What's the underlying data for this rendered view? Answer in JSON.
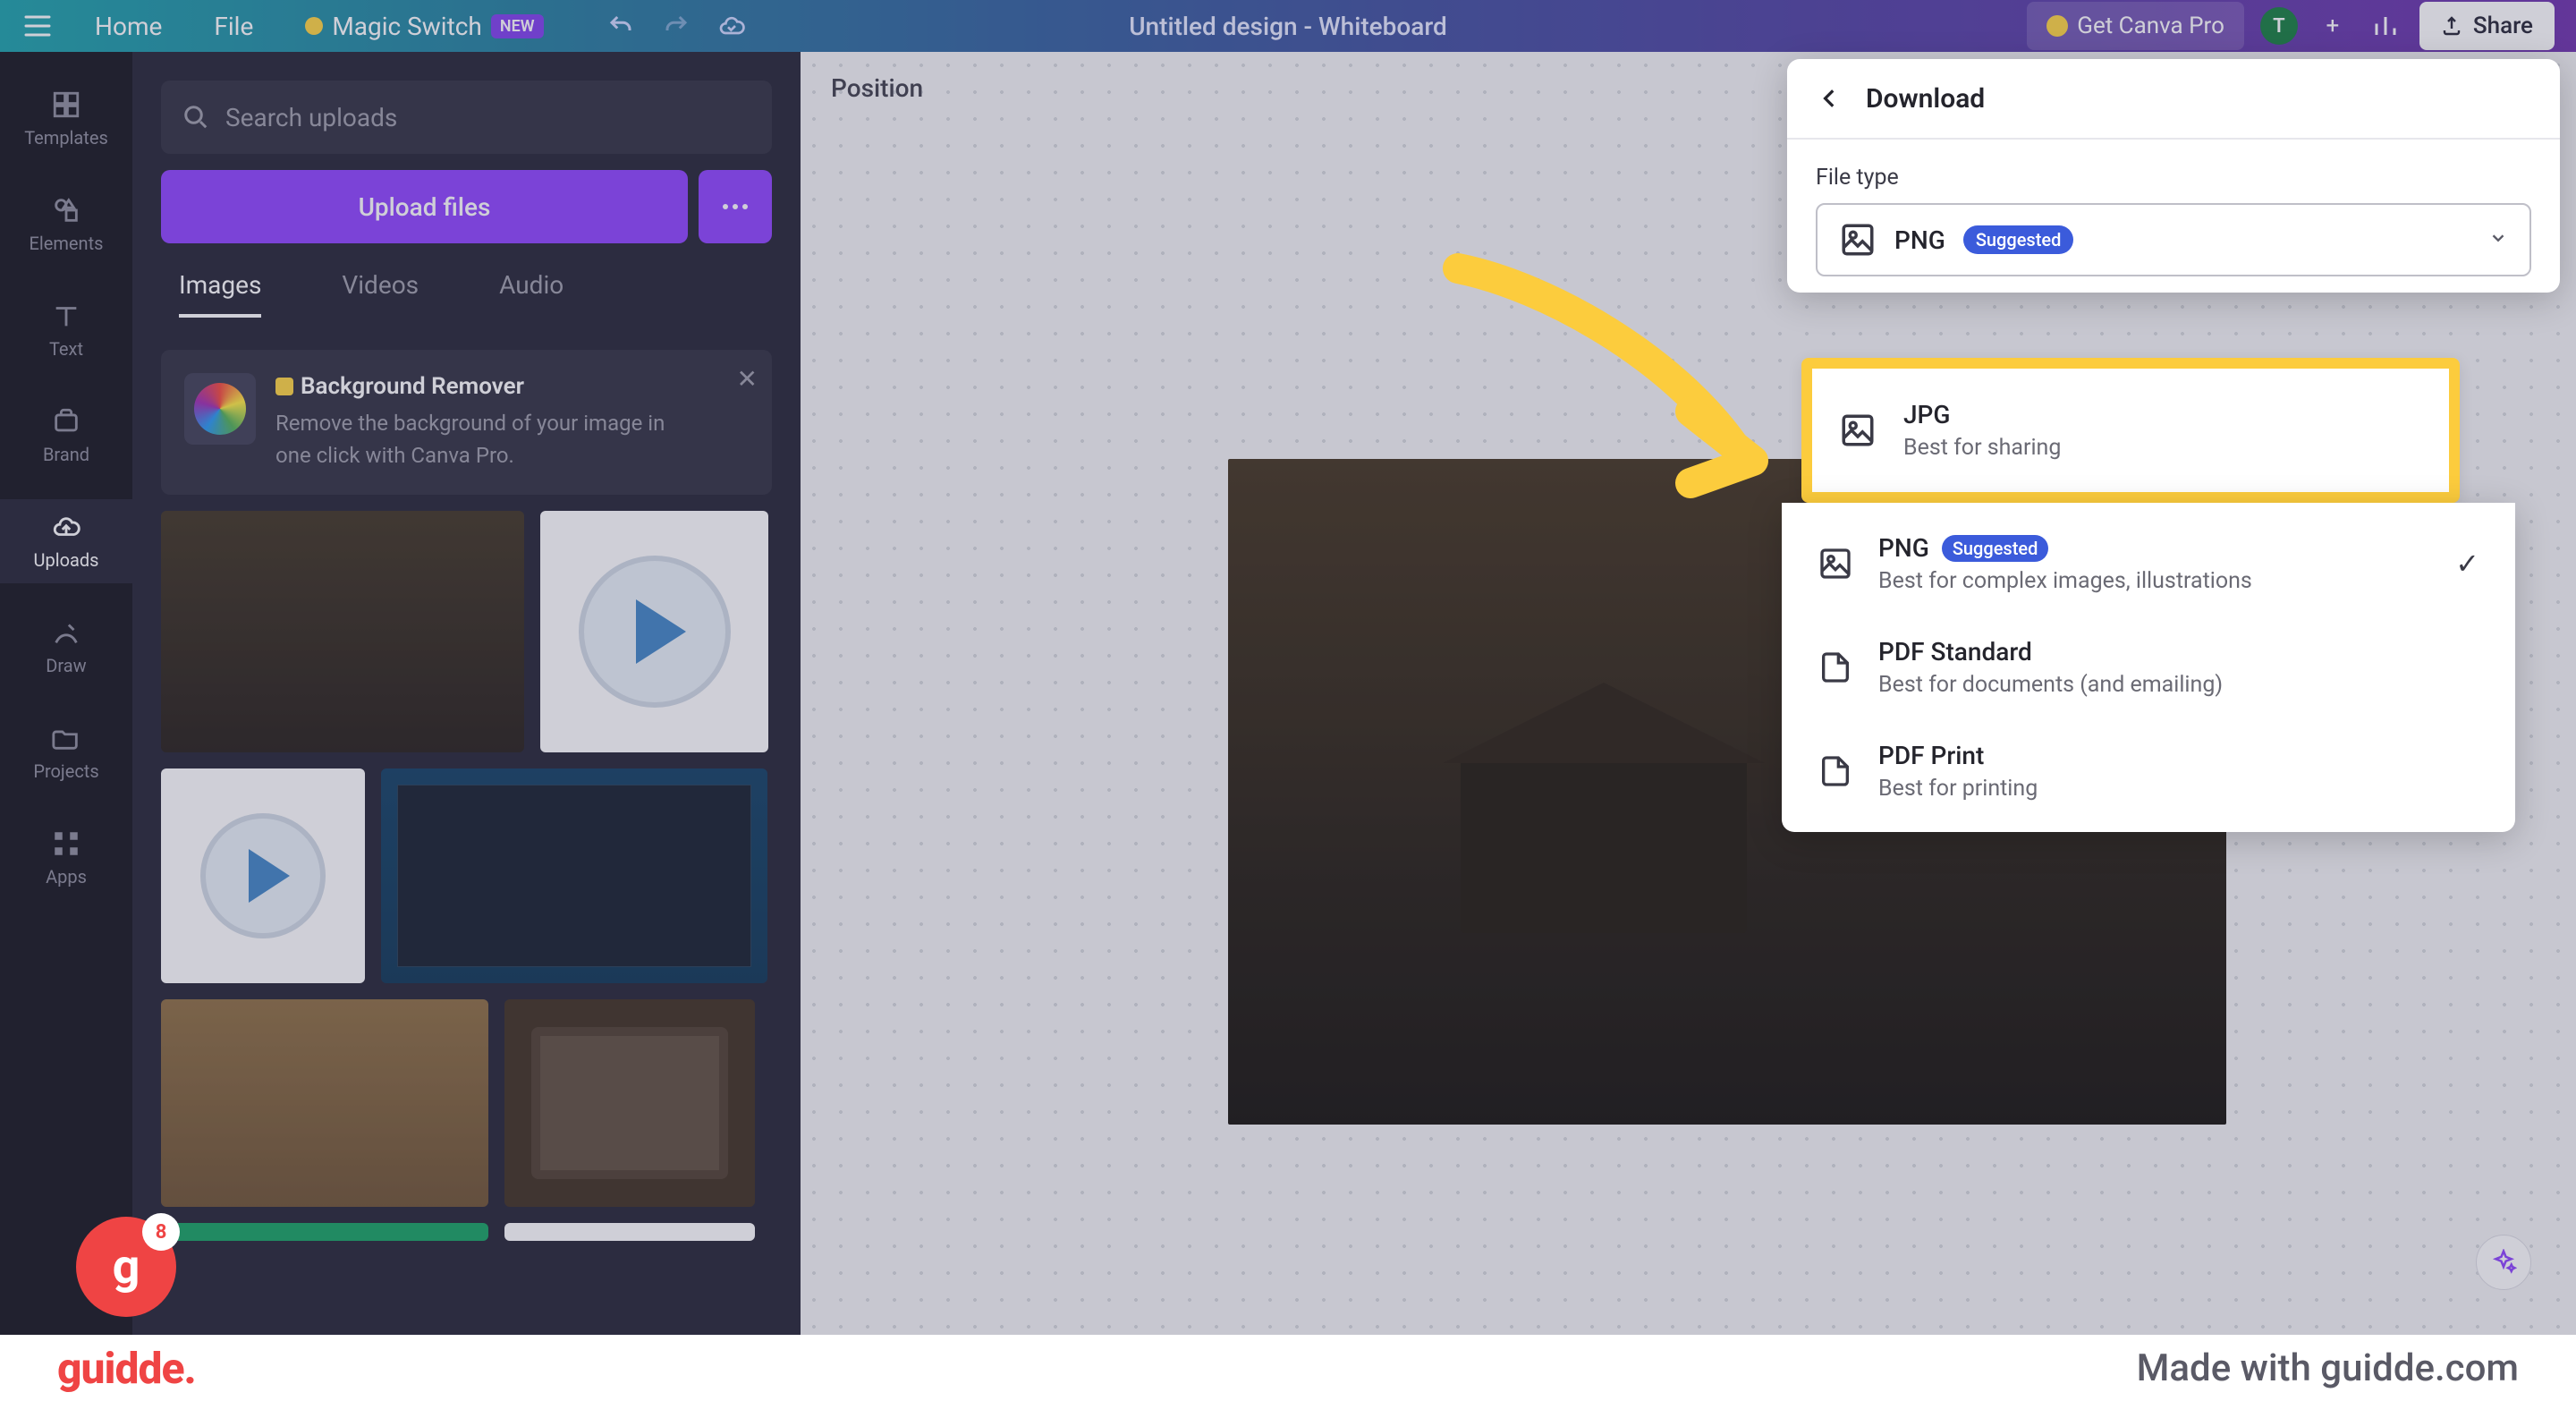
{
  "topbar": {
    "home": "Home",
    "file": "File",
    "magic": "Magic Switch",
    "magic_badge": "NEW",
    "title": "Untitled design - Whiteboard",
    "getpro": "Get Canva Pro",
    "avatar": "T",
    "share": "Share"
  },
  "rail": [
    {
      "name": "templates",
      "label": "Templates"
    },
    {
      "name": "elements",
      "label": "Elements"
    },
    {
      "name": "text",
      "label": "Text"
    },
    {
      "name": "brand",
      "label": "Brand"
    },
    {
      "name": "uploads",
      "label": "Uploads"
    },
    {
      "name": "draw",
      "label": "Draw"
    },
    {
      "name": "projects",
      "label": "Projects"
    },
    {
      "name": "apps",
      "label": "Apps"
    }
  ],
  "panel": {
    "search_ph": "Search uploads",
    "upload": "Upload files",
    "tabs": [
      "Images",
      "Videos",
      "Audio"
    ],
    "promo_title": "Background Remover",
    "promo_body": "Remove the background of your image in one click with Canva Pro."
  },
  "canvas": {
    "position": "Position"
  },
  "download": {
    "title": "Download",
    "filetype_label": "File type",
    "selected": "PNG",
    "suggested": "Suggested",
    "options": [
      {
        "name": "JPG",
        "desc": "Best for sharing"
      },
      {
        "name": "PNG",
        "desc": "Best for complex images, illustrations",
        "suggested": true,
        "checked": true
      },
      {
        "name": "PDF Standard",
        "desc": "Best for documents (and emailing)"
      },
      {
        "name": "PDF Print",
        "desc": "Best for printing"
      }
    ]
  },
  "footer": {
    "brand": "guidde.",
    "made": "Made with guidde.com"
  },
  "gbadge": {
    "letter": "g",
    "count": "8"
  }
}
